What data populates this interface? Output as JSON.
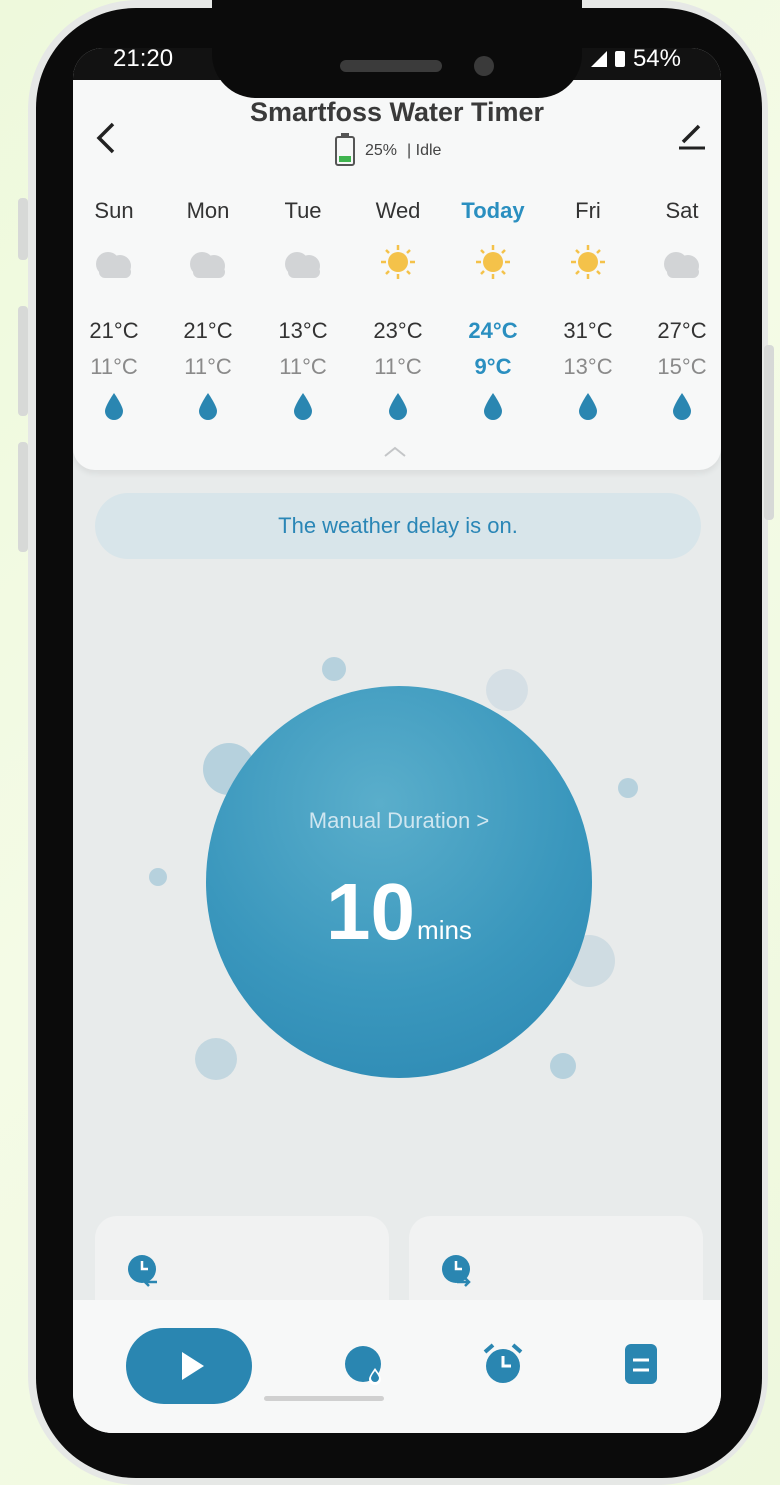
{
  "status": {
    "time": "21:20",
    "battery": "54%"
  },
  "header": {
    "title": "Smartfoss Water Timer",
    "battery": "25%",
    "state": "| Idle"
  },
  "weather": {
    "days": [
      {
        "name": "Sun",
        "icon": "cloud-icon",
        "high": "21°C",
        "low": "11°C"
      },
      {
        "name": "Mon",
        "icon": "cloud-icon",
        "high": "21°C",
        "low": "11°C"
      },
      {
        "name": "Tue",
        "icon": "cloud-icon",
        "high": "13°C",
        "low": "11°C"
      },
      {
        "name": "Wed",
        "icon": "sun-icon",
        "high": "23°C",
        "low": "11°C"
      },
      {
        "name": "Today",
        "icon": "sun-icon",
        "high": "24°C",
        "low": "9°C"
      },
      {
        "name": "Fri",
        "icon": "sun-icon",
        "high": "31°C",
        "low": "13°C"
      },
      {
        "name": "Sat",
        "icon": "cloud-icon",
        "high": "27°C",
        "low": "15°C"
      }
    ]
  },
  "banner": {
    "text": "The weather delay is on."
  },
  "manual": {
    "label": "Manual Duration >",
    "value": "10",
    "unit": "mins"
  },
  "colors": {
    "accent": "#2a86b1",
    "today": "#2a8fc0",
    "sun": "#f4c24a",
    "cloud": "#d2d4d6"
  }
}
